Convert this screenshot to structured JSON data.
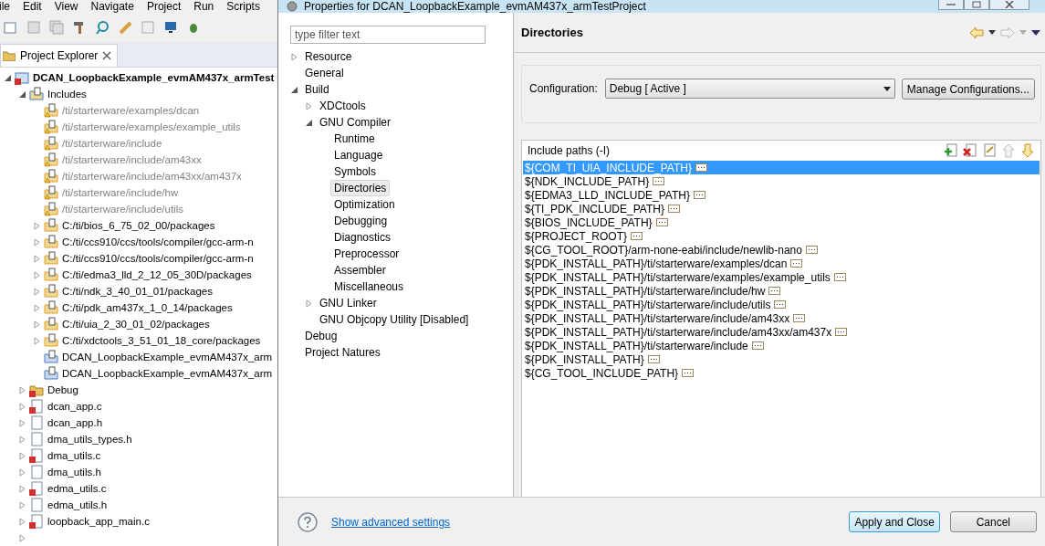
{
  "ide": {
    "menu": [
      "ile",
      "Edit",
      "View",
      "Navigate",
      "Project",
      "Run",
      "Scripts"
    ],
    "explorer_tab": {
      "label": "Project Explorer"
    },
    "explorer_tree": [
      {
        "label": "DCAN_LoopbackExample_evmAM437x_armTest",
        "kind": "project",
        "error": true,
        "expanded": true,
        "children": [
          {
            "label": "Includes",
            "kind": "includes",
            "error": false,
            "expanded": true,
            "children": [
              {
                "label": "/ti/starterware/examples/dcan",
                "kind": "missing-include",
                "error": false
              },
              {
                "label": "/ti/starterware/examples/example_utils",
                "kind": "missing-include",
                "error": false
              },
              {
                "label": "/ti/starterware/include",
                "kind": "missing-include",
                "error": false
              },
              {
                "label": "/ti/starterware/include/am43xx",
                "kind": "missing-include",
                "error": false
              },
              {
                "label": "/ti/starterware/include/am43xx/am437x",
                "kind": "missing-include",
                "error": false
              },
              {
                "label": "/ti/starterware/include/hw",
                "kind": "missing-include",
                "error": false
              },
              {
                "label": "/ti/starterware/include/utils",
                "kind": "missing-include",
                "error": false
              },
              {
                "label": "C:/ti/bios_6_75_02_00/packages",
                "kind": "include-folder",
                "error": false,
                "expanded": false
              },
              {
                "label": "C:/ti/ccs910/ccs/tools/compiler/gcc-arm-n",
                "kind": "include-folder",
                "error": false,
                "expanded": false
              },
              {
                "label": "C:/ti/ccs910/ccs/tools/compiler/gcc-arm-n",
                "kind": "include-folder",
                "error": false,
                "expanded": false
              },
              {
                "label": "C:/ti/edma3_lld_2_12_05_30D/packages",
                "kind": "include-folder",
                "error": false,
                "expanded": false
              },
              {
                "label": "C:/ti/ndk_3_40_01_01/packages",
                "kind": "include-folder",
                "error": false,
                "expanded": false
              },
              {
                "label": "C:/ti/pdk_am437x_1_0_14/packages",
                "kind": "include-folder",
                "error": false,
                "expanded": false
              },
              {
                "label": "C:/ti/uia_2_30_01_02/packages",
                "kind": "include-folder",
                "error": false,
                "expanded": false
              },
              {
                "label": "C:/ti/xdctools_3_51_01_18_core/packages",
                "kind": "include-folder",
                "error": false,
                "expanded": false
              },
              {
                "label": "DCAN_LoopbackExample_evmAM437x_arm",
                "kind": "linked-include",
                "error": false
              },
              {
                "label": "DCAN_LoopbackExample_evmAM437x_arm",
                "kind": "linked-include",
                "error": false
              }
            ]
          },
          {
            "label": "Debug",
            "kind": "folder",
            "error": true,
            "expanded": false
          },
          {
            "label": "dcan_app.c",
            "kind": "c-file",
            "error": true,
            "expanded": false
          },
          {
            "label": "dcan_app.h",
            "kind": "h-file",
            "error": false,
            "expanded": false
          },
          {
            "label": "dma_utils_types.h",
            "kind": "h-file",
            "error": false,
            "expanded": false
          },
          {
            "label": "dma_utils.c",
            "kind": "c-file",
            "error": true,
            "expanded": false
          },
          {
            "label": "dma_utils.h",
            "kind": "h-file",
            "error": false,
            "expanded": false
          },
          {
            "label": "edma_utils.c",
            "kind": "c-file",
            "error": true,
            "expanded": false
          },
          {
            "label": "edma_utils.h",
            "kind": "h-file",
            "error": false,
            "expanded": false
          },
          {
            "label": "loopback_app_main.c",
            "kind": "c-file",
            "error": true,
            "expanded": false
          }
        ]
      }
    ]
  },
  "dialog": {
    "title": "Properties for DCAN_LoopbackExample_evmAM437x_armTestProject",
    "filter": {
      "placeholder": "type filter text"
    },
    "tree": [
      {
        "label": "Resource",
        "expanded": false,
        "selected": false
      },
      {
        "label": "General",
        "selected": false
      },
      {
        "label": "Build",
        "expanded": true,
        "selected": false,
        "children": [
          {
            "label": "XDCtools",
            "expanded": false,
            "selected": false
          },
          {
            "label": "GNU Compiler",
            "expanded": true,
            "selected": false,
            "children": [
              {
                "label": "Runtime",
                "selected": false
              },
              {
                "label": "Language",
                "selected": false
              },
              {
                "label": "Symbols",
                "selected": false
              },
              {
                "label": "Directories",
                "selected": true
              },
              {
                "label": "Optimization",
                "selected": false
              },
              {
                "label": "Debugging",
                "selected": false
              },
              {
                "label": "Diagnostics",
                "selected": false
              },
              {
                "label": "Preprocessor",
                "selected": false
              },
              {
                "label": "Assembler",
                "selected": false
              },
              {
                "label": "Miscellaneous",
                "selected": false
              }
            ]
          },
          {
            "label": "GNU Linker",
            "expanded": false,
            "selected": false
          },
          {
            "label": "GNU Objcopy Utility  [Disabled]",
            "selected": false
          }
        ]
      },
      {
        "label": "Debug",
        "selected": false
      },
      {
        "label": "Project Natures",
        "selected": false
      }
    ],
    "page_title": "Directories",
    "configuration": {
      "label": "Configuration:",
      "value": "Debug  [ Active ]",
      "manage_button": "Manage Configurations..."
    },
    "include_paths": {
      "title": "Include paths (-I)",
      "items": [
        {
          "path": "${COM_TI_UIA_INCLUDE_PATH}",
          "selected": true
        },
        {
          "path": "${NDK_INCLUDE_PATH}",
          "selected": false
        },
        {
          "path": "${EDMA3_LLD_INCLUDE_PATH}",
          "selected": false
        },
        {
          "path": "${TI_PDK_INCLUDE_PATH}",
          "selected": false
        },
        {
          "path": "${BIOS_INCLUDE_PATH}",
          "selected": false
        },
        {
          "path": "${PROJECT_ROOT}",
          "selected": false
        },
        {
          "path": "${CG_TOOL_ROOT}/arm-none-eabi/include/newlib-nano",
          "selected": false
        },
        {
          "path": "${PDK_INSTALL_PATH}/ti/starterware/examples/dcan",
          "selected": false
        },
        {
          "path": "${PDK_INSTALL_PATH}/ti/starterware/examples/example_utils",
          "selected": false
        },
        {
          "path": "${PDK_INSTALL_PATH}/ti/starterware/include/hw",
          "selected": false
        },
        {
          "path": "${PDK_INSTALL_PATH}/ti/starterware/include/utils",
          "selected": false
        },
        {
          "path": "${PDK_INSTALL_PATH}/ti/starterware/include/am43xx",
          "selected": false
        },
        {
          "path": "${PDK_INSTALL_PATH}/ti/starterware/include/am43xx/am437x",
          "selected": false
        },
        {
          "path": "${PDK_INSTALL_PATH}/ti/starterware/include",
          "selected": false
        },
        {
          "path": "${PDK_INSTALL_PATH}",
          "selected": false
        },
        {
          "path": "${CG_TOOL_INCLUDE_PATH}",
          "selected": false
        }
      ]
    },
    "help_link": "Show advanced settings",
    "buttons": [
      {
        "label": "Apply and Close",
        "default": true
      },
      {
        "label": "Cancel",
        "default": false
      }
    ]
  }
}
